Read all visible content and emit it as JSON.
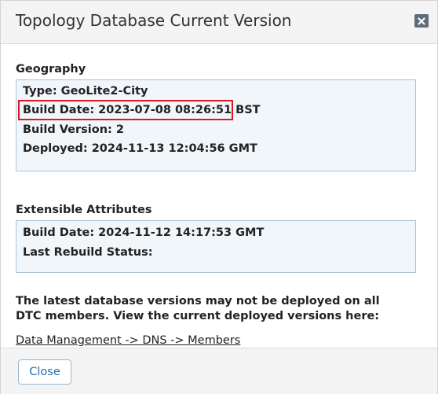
{
  "dialog": {
    "title": "Topology Database Current Version",
    "close_icon": "close-x-icon"
  },
  "geography": {
    "heading": "Geography",
    "type": "Type: GeoLite2-City",
    "build_date": "Build Date: 2023-07-08 08:26:51 BST",
    "build_version": "Build Version: 2",
    "deployed": "Deployed: 2024-11-13 12:04:56 GMT"
  },
  "extensible_attributes": {
    "heading": "Extensible Attributes",
    "build_date": "Build Date: 2024-11-12 14:17:53 GMT",
    "last_rebuild_status": "Last Rebuild Status:"
  },
  "note": "The latest database versions may not be deployed on all DTC members. View the current deployed versions here:",
  "link": "Data Management -> DNS -> Members",
  "footer": {
    "close_label": "Close"
  },
  "colors": {
    "highlight": "#d9181f",
    "box_bg": "#f1f6fb",
    "box_border": "#a8c3d9",
    "button_text": "#2a6cb0"
  }
}
